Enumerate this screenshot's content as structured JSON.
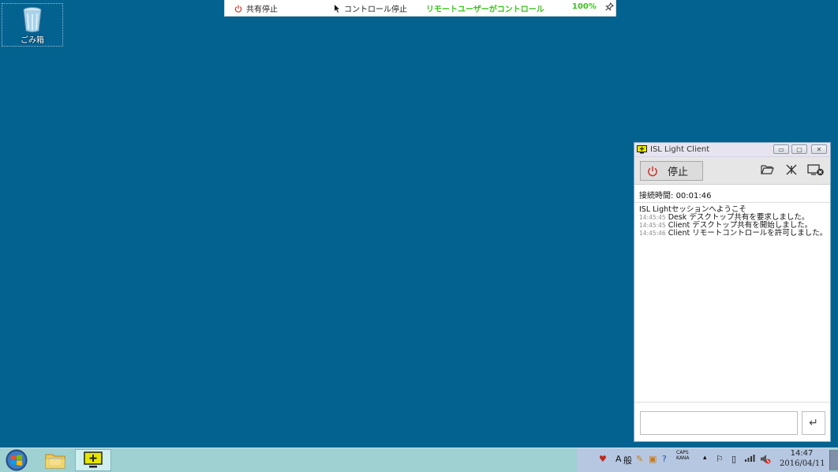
{
  "desktop": {
    "recycle_bin_label": "ごみ箱"
  },
  "control_bar": {
    "stop_share": "共有停止",
    "stop_control": "コントロール停止",
    "status": "リモートユーザーがコントロール",
    "zoom": "100%"
  },
  "client": {
    "title": "ISL Light Client",
    "stop_label": "停止",
    "connection_time_label": "接続時間:",
    "connection_time_value": "00:01:46",
    "log": {
      "welcome": "ISL Lightセッションへようこそ",
      "entries": [
        {
          "time": "14:45:45",
          "text": "Desk デスクトップ共有を要求しました。"
        },
        {
          "time": "14:45:45",
          "text": "Client デスクトップ共有を開始しました。"
        },
        {
          "time": "14:45:46",
          "text": "Client リモートコントロールを許可しました。"
        }
      ]
    }
  },
  "taskbar": {
    "ime_mode": "A",
    "ime_label": "般",
    "caps": "CAPS",
    "kana": "KANA",
    "time": "14:47",
    "date": "2016/04/11"
  },
  "colors": {
    "desktop": "#03628f",
    "status_green": "#3cc21d",
    "stop_red": "#d8322a",
    "taskbar": "#9fd0d2"
  }
}
